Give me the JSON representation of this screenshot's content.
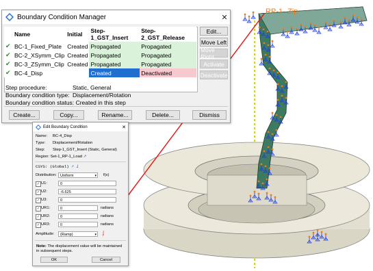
{
  "model_labels": {
    "rp_label": "RP-1",
    "rp_suffix": "Zip"
  },
  "colors": {
    "accent_select": "#1f6fd1",
    "propagated_bg": "#d9f2d9",
    "deactivated_bg": "#f7c9cf",
    "model_solid": "#3e7a60",
    "model_light": "#e6e3d6",
    "bc_glyph": "#1f3fe0",
    "bc_tip": "#f07a1a",
    "axis_line": "#d8d800",
    "link_line": "#e02020"
  },
  "manager": {
    "title": "Boundary Condition Manager",
    "close_icon": "close-icon",
    "columns": [
      "Name",
      "Initial",
      "Step-1_GST_Insert",
      "Step-2_GST_Release"
    ],
    "rows": [
      {
        "name": "BC-1_Fixed_Plate",
        "initial": "Created",
        "step1": "Propagated",
        "step2": "Propagated"
      },
      {
        "name": "BC-2_XSymm_Clip",
        "initial": "Created",
        "step1": "Propagated",
        "step2": "Propagated"
      },
      {
        "name": "BC-3_ZSymm_Clip",
        "initial": "Created",
        "step1": "Propagated",
        "step2": "Propagated"
      },
      {
        "name": "BC-4_Disp",
        "initial": "",
        "step1": "Created",
        "step2": "Deactivated"
      }
    ],
    "side_buttons": [
      "Edit...",
      "Move Left",
      "Move Right",
      "Activate",
      "Deactivate"
    ],
    "info": {
      "step_procedure_label": "Step procedure:",
      "step_procedure_value": "Static, General",
      "bc_type_label": "Boundary condition type:",
      "bc_type_value": "Displacement/Rotation",
      "bc_status_label": "Boundary condition status:",
      "bc_status_value": "Created in this step"
    },
    "bottom_buttons": [
      "Create...",
      "Copy...",
      "Rename...",
      "Delete...",
      "Dismiss"
    ]
  },
  "editor": {
    "title": "Edit Boundary Condition",
    "name_label": "Name:",
    "name_value": "BC-4_Disp",
    "type_label": "Type:",
    "type_value": "Displacement/Rotation",
    "step_label": "Step:",
    "step_value": "Step-1_GST_Insert (Static, General)",
    "region_label": "Region:",
    "region_value": "Set-1_RP-1_Load",
    "csys_label": "CSYS:",
    "csys_value": "(Global)",
    "distribution_label": "Distribution:",
    "distribution_value": "Uniform",
    "fx_label": "f(x)",
    "fields": [
      {
        "label": "U1:",
        "value": "0",
        "checked": true,
        "unit": ""
      },
      {
        "label": "U2:",
        "value": "-6.625",
        "checked": true,
        "unit": ""
      },
      {
        "label": "U3:",
        "value": "0",
        "checked": true,
        "unit": ""
      },
      {
        "label": "UR1:",
        "value": "0",
        "checked": true,
        "unit": "radians"
      },
      {
        "label": "UR2:",
        "value": "0",
        "checked": true,
        "unit": "radians"
      },
      {
        "label": "UR3:",
        "value": "0",
        "checked": true,
        "unit": "radians"
      }
    ],
    "amplitude_label": "Amplitude:",
    "amplitude_value": "(Ramp)",
    "note_bold": "Note:",
    "note_text": "The displacement value will be maintained in subsequent steps.",
    "ok_label": "OK",
    "cancel_label": "Cancel"
  }
}
